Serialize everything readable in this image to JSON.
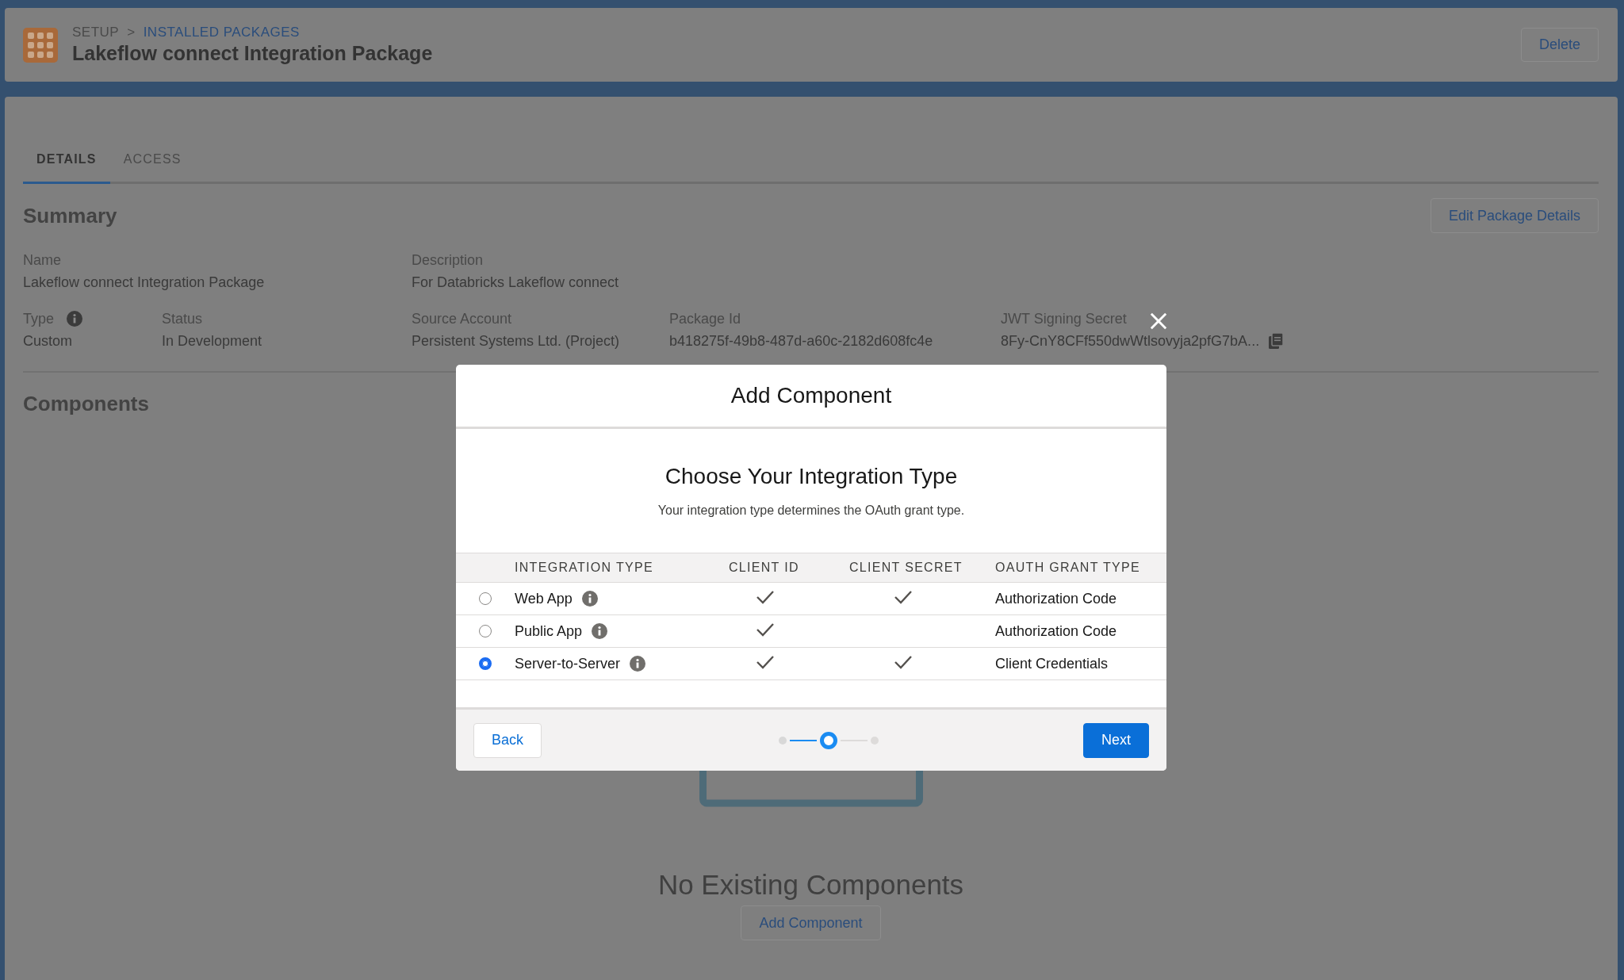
{
  "header": {
    "breadcrumb": [
      {
        "label": "SETUP",
        "link": false
      },
      {
        "label": "INSTALLED PACKAGES",
        "link": true
      }
    ],
    "separator": ">",
    "title": "Lakeflow connect Integration Package",
    "action": "Delete"
  },
  "tabs": [
    {
      "label": "DETAILS",
      "selected": true
    },
    {
      "label": "ACCESS",
      "selected": false
    }
  ],
  "summary": {
    "heading": "Summary",
    "action": "Edit Package Details",
    "rows": [
      [
        {
          "kind": "plain",
          "label": "Name",
          "value": "Lakeflow connect Integration Package"
        },
        "",
        {
          "kind": "plain",
          "label": "Description",
          "value": "For Databricks Lakeflow connect"
        }
      ],
      [
        {
          "kind": "info",
          "label": "Type",
          "value": "Custom"
        },
        {
          "kind": "plain",
          "label": "Status",
          "value": "In Development"
        },
        {
          "kind": "plain",
          "label": "Source Account",
          "value": "Persistent Systems Ltd. (Project)"
        },
        {
          "kind": "plain",
          "label": "Package Id",
          "value": "b418275f-49b8-487d-a60c-2182d608fc4e"
        },
        {
          "kind": "copy",
          "label": "JWT Signing Secret",
          "value": "8Fy-CnY8CFf550dwWtlsovyja2pfG7bA..."
        }
      ]
    ]
  },
  "components": {
    "heading": "Components",
    "empty_title": "No Existing Components",
    "action": "Add Component"
  },
  "modal": {
    "title": "Add Component",
    "heading": "Choose Your Integration Type",
    "subtitle": "Your integration type determines the OAuth grant type.",
    "columns": [
      "INTEGRATION TYPE",
      "CLIENT ID",
      "CLIENT SECRET",
      "OAUTH GRANT TYPE"
    ],
    "rows": [
      {
        "type": "Web App",
        "client_id": true,
        "client_secret": true,
        "grant": "Authorization Code",
        "selected": false
      },
      {
        "type": "Public App",
        "client_id": true,
        "client_secret": false,
        "grant": "Authorization Code",
        "selected": false
      },
      {
        "type": "Server-to-Server",
        "client_id": true,
        "client_secret": true,
        "grant": "Client Credentials",
        "selected": true
      }
    ],
    "back": "Back",
    "next": "Next",
    "steps": [
      {
        "selected": false
      },
      {
        "selected": true
      },
      {
        "selected": false
      }
    ]
  }
}
